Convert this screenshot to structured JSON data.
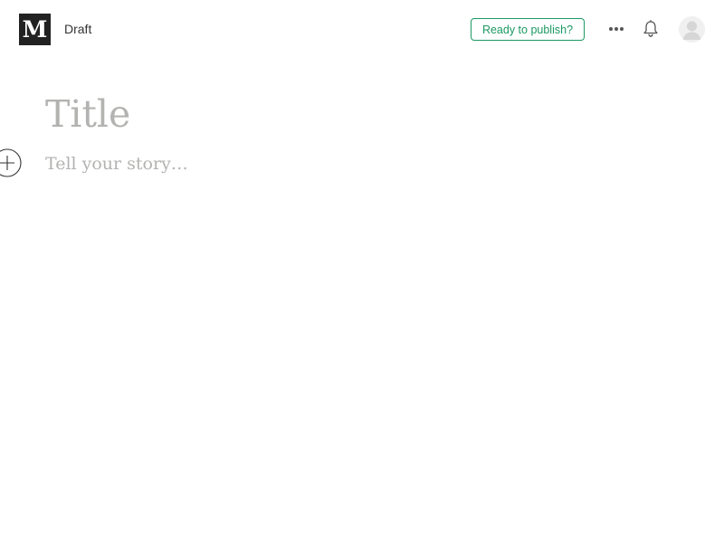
{
  "header": {
    "logo_letter": "M",
    "status": "Draft",
    "publish_label": "Ready to publish?",
    "icons": {
      "more": "more-horizontal-icon",
      "notifications": "bell-icon",
      "avatar": "user-avatar-icon"
    }
  },
  "editor": {
    "title_placeholder": "Title",
    "body_placeholder": "Tell your story…",
    "add_icon": "plus-circle-icon"
  },
  "colors": {
    "brand_green": "#1c9963",
    "logo_bg": "#222222",
    "placeholder": "#b3b3b1"
  }
}
